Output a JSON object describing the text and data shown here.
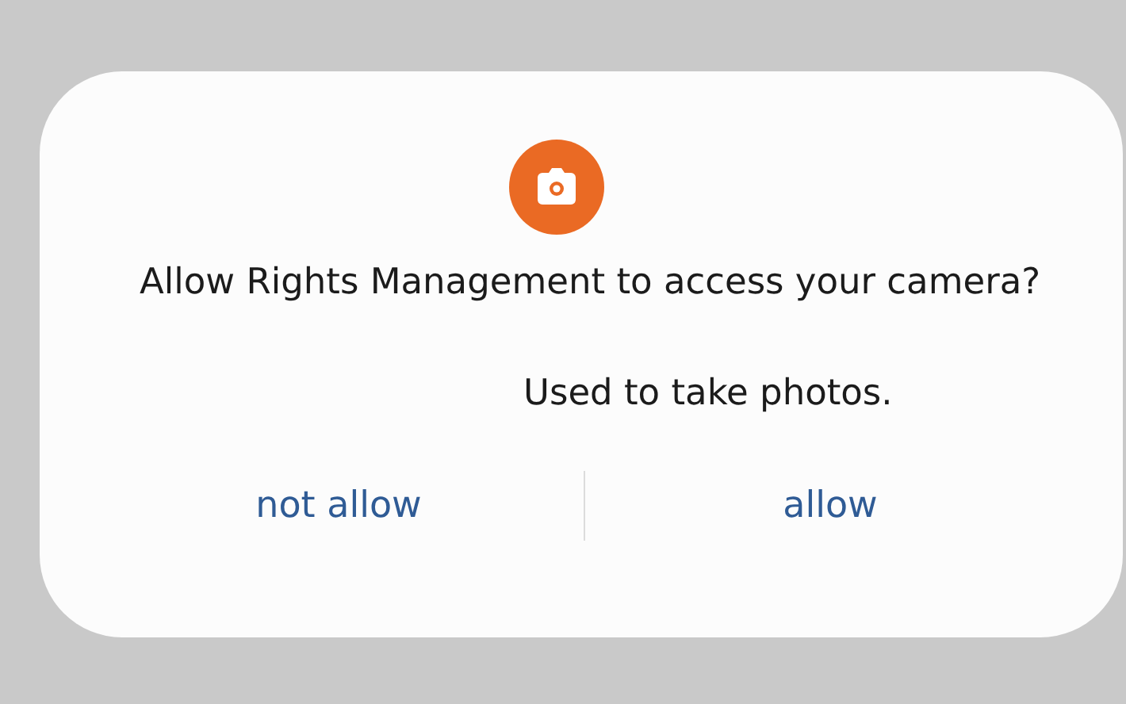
{
  "dialog": {
    "title": "Allow Rights Management to access your camera?",
    "message": "Used to take photos.",
    "buttons": [
      {
        "label": "not allow"
      },
      {
        "label": "allow"
      }
    ]
  }
}
